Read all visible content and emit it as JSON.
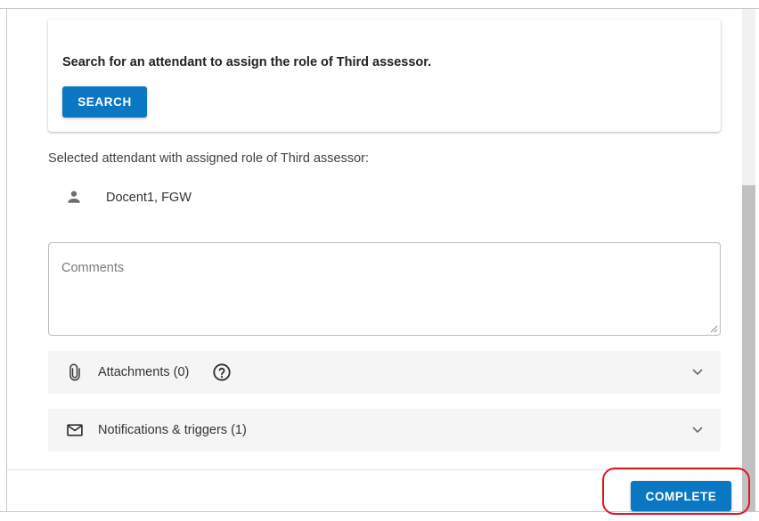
{
  "search_card": {
    "instruction": "Search for an attendant to assign the role of Third assessor.",
    "search_button": "SEARCH"
  },
  "selection": {
    "label": "Selected attendant with assigned role of Third assessor:",
    "attendant_name": "Docent1, FGW",
    "icon": "person-icon"
  },
  "comments": {
    "placeholder": "Comments",
    "value": ""
  },
  "sections": {
    "attachments": {
      "label": "Attachments (0)",
      "icon": "paperclip-icon",
      "help_icon": "help-circle-icon",
      "expand_icon": "chevron-down-icon"
    },
    "notifications": {
      "label": "Notifications & triggers (1)",
      "icon": "envelope-icon",
      "expand_icon": "chevron-down-icon"
    }
  },
  "footer": {
    "complete_button": "COMPLETE"
  },
  "colors": {
    "primary": "#0a77c2",
    "highlight": "#e0161e",
    "panel_background": "#f5f5f5"
  }
}
